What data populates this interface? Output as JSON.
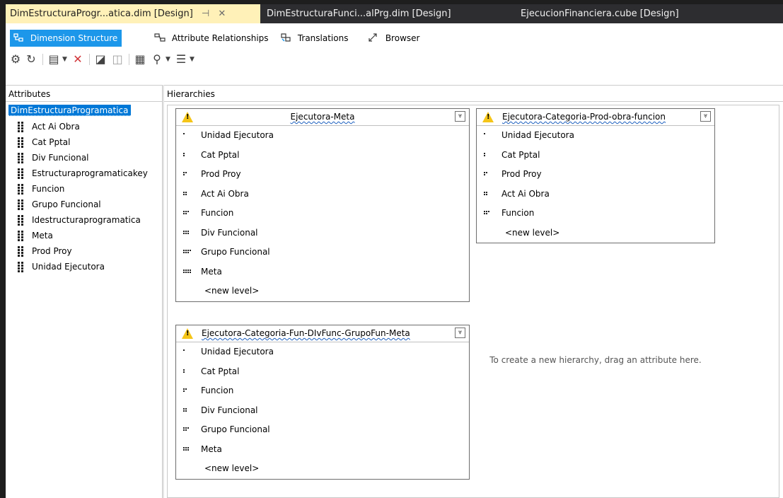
{
  "tabs": [
    {
      "label": "DimEstructuraProgr...atica.dim [Design]",
      "active": true
    },
    {
      "label": "DimEstructuraFunci...alPrg.dim [Design]",
      "active": false
    },
    {
      "label": "EjecucionFinanciera.cube [Design]",
      "active": false
    }
  ],
  "tab_pin_glyph": "⊣",
  "tab_close_glyph": "✕",
  "subtabs": [
    {
      "label": "Dimension Structure",
      "icon": "dimension-structure-icon",
      "selected": true
    },
    {
      "label": "Attribute Relationships",
      "icon": "attribute-relationships-icon",
      "selected": false
    },
    {
      "label": "Translations",
      "icon": "translations-icon",
      "selected": false
    },
    {
      "label": "Browser",
      "icon": "browser-icon",
      "selected": false
    }
  ],
  "attributes": {
    "header": "Attributes",
    "root": "DimEstructuraProgramatica",
    "items": [
      "Act Ai Obra",
      "Cat Pptal",
      "Div Funcional",
      "Estructuraprogramaticakey",
      "Funcion",
      "Grupo Funcional",
      "Idestructuraprogramatica",
      "Meta",
      "Prod Proy",
      "Unidad Ejecutora"
    ]
  },
  "hierarchies": {
    "header": "Hierarchies",
    "boxes": [
      {
        "title": "Ejecutora-Meta",
        "levels": [
          "Unidad Ejecutora",
          "Cat Pptal",
          "Prod Proy",
          "Act Ai Obra",
          "Funcion",
          "Div Funcional",
          "Grupo Funcional",
          "Meta"
        ],
        "new_level": "<new level>"
      },
      {
        "title": "Ejecutora-Categoria-Prod-obra-funcion",
        "levels": [
          "Unidad Ejecutora",
          "Cat Pptal",
          "Prod Proy",
          "Act Ai Obra",
          "Funcion"
        ],
        "new_level": "<new level>"
      },
      {
        "title": "Ejecutora-Categoria-Fun-DIvFunc-GrupoFun-Meta",
        "levels": [
          "Unidad Ejecutora",
          "Cat Pptal",
          "Funcion",
          "Div Funcional",
          "Grupo Funcional",
          "Meta"
        ],
        "new_level": "<new level>"
      }
    ],
    "hint": "To create a new hierarchy, drag an attribute here."
  },
  "colors": {
    "active_tab": "#fff1b8",
    "selection": "#0078d7",
    "selected_subtab": "#1c97ea",
    "warning": "#f5c518"
  }
}
